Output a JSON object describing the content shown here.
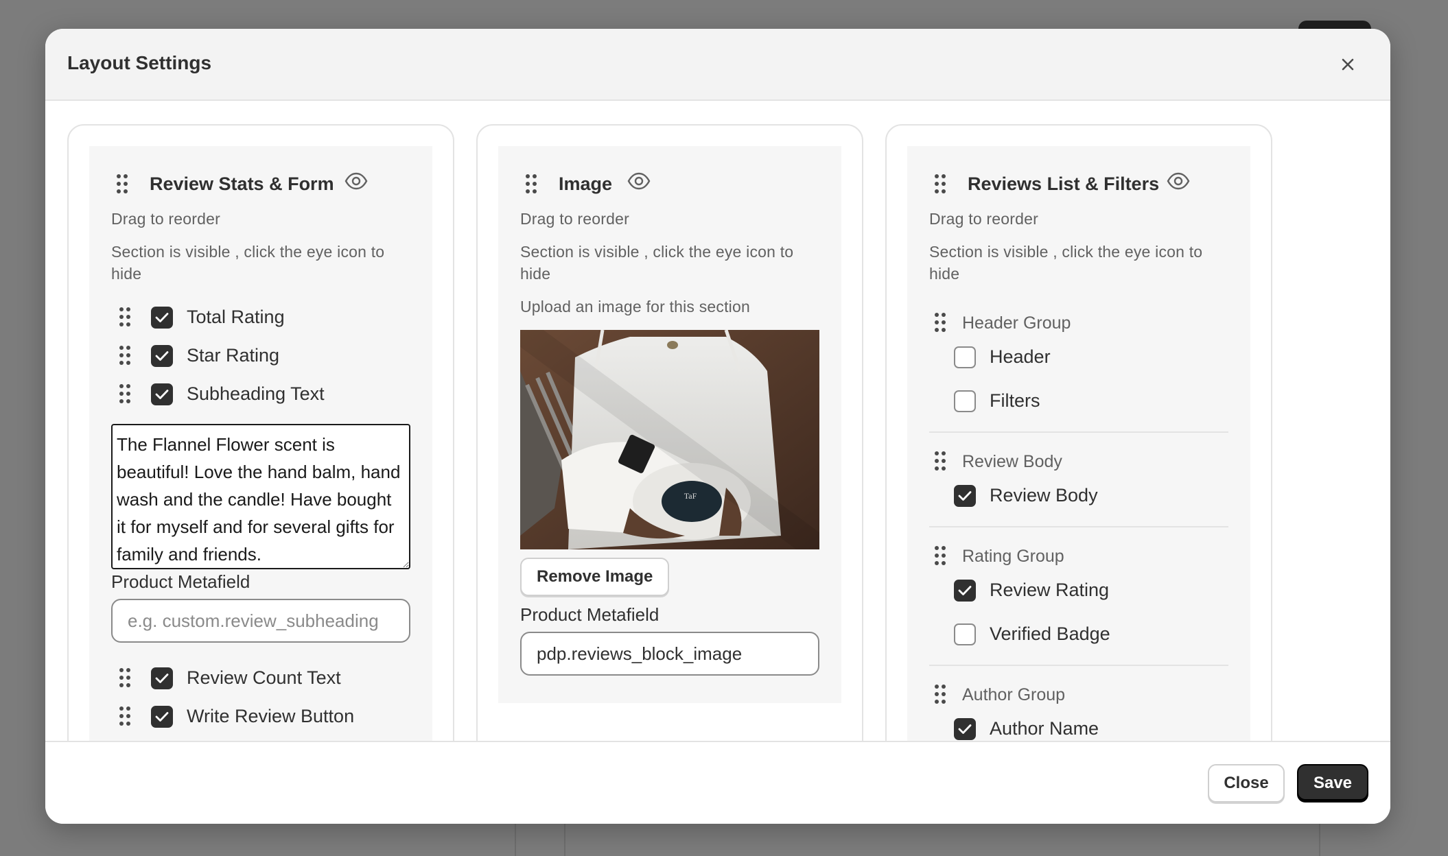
{
  "modal": {
    "title": "Layout Settings"
  },
  "sections": [
    {
      "title": "Review Stats & Form",
      "drag_hint": "Drag to reorder",
      "visibility_hint": "Section is visible , click the eye icon to hide",
      "items": [
        {
          "label": "Total Rating",
          "checked": true
        },
        {
          "label": "Star Rating",
          "checked": true
        },
        {
          "label": "Subheading Text",
          "checked": true
        },
        {
          "label": "Review Count Text",
          "checked": true
        },
        {
          "label": "Write Review Button",
          "checked": true
        }
      ],
      "subheading_text": "The Flannel Flower scent is beautiful! Love the hand balm, hand wash and the candle! Have bought it for myself and for several gifts for family and friends.",
      "metafield_label": "Product Metafield",
      "metafield_placeholder": "e.g. custom.review_subheading",
      "metafield_value": ""
    },
    {
      "title": "Image",
      "drag_hint": "Drag to reorder",
      "visibility_hint": "Section is visible , click the eye icon to hide",
      "upload_hint": "Upload an image for this section",
      "remove_button": "Remove Image",
      "metafield_label": "Product Metafield",
      "metafield_value": "pdp.reviews_block_image",
      "image_label": "TaF"
    },
    {
      "title": "Reviews List & Filters",
      "drag_hint": "Drag to reorder",
      "visibility_hint": "Section is visible , click the eye icon to hide",
      "groups": [
        {
          "label": "Header Group",
          "items": [
            {
              "label": "Header",
              "checked": false
            },
            {
              "label": "Filters",
              "checked": false
            }
          ]
        },
        {
          "label": "Review Body",
          "items": [
            {
              "label": "Review Body",
              "checked": true
            }
          ]
        },
        {
          "label": "Rating Group",
          "items": [
            {
              "label": "Review Rating",
              "checked": true
            },
            {
              "label": "Verified Badge",
              "checked": false
            }
          ]
        },
        {
          "label": "Author Group",
          "items": [
            {
              "label": "Author Name",
              "checked": true
            }
          ]
        }
      ]
    }
  ],
  "footer": {
    "close_label": "Close",
    "save_label": "Save"
  }
}
